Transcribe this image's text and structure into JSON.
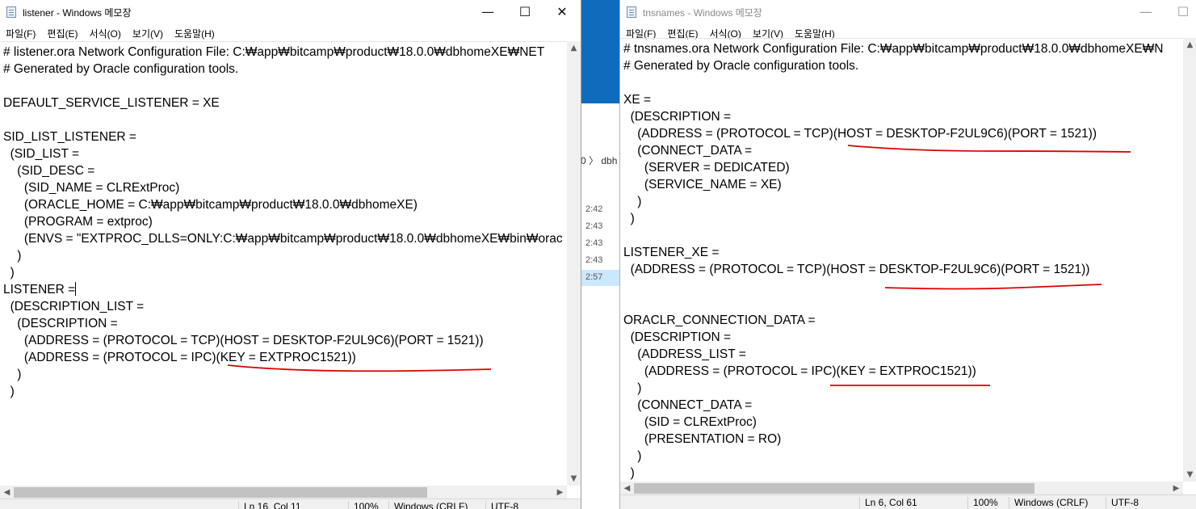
{
  "left_window": {
    "title": "listener - Windows 메모장",
    "controls": {
      "minimize": "—",
      "maximize": "☐",
      "close": "✕"
    },
    "menu": [
      "파일(F)",
      "편집(E)",
      "서식(O)",
      "보기(V)",
      "도움말(H)"
    ],
    "content": "# listener.ora Network Configuration File: C:\\app\\bitcamp\\product\\18.0.0\\dbhomeXE\\NET\n# Generated by Oracle configuration tools.\n\nDEFAULT_SERVICE_LISTENER = XE\n\nSID_LIST_LISTENER =\n  (SID_LIST =\n    (SID_DESC =\n      (SID_NAME = CLRExtProc)\n      (ORACLE_HOME = C:\\app\\bitcamp\\product\\18.0.0\\dbhomeXE)\n      (PROGRAM = extproc)\n      (ENVS = \"EXTPROC_DLLS=ONLY:C:\\app\\bitcamp\\product\\18.0.0\\dbhomeXE\\bin\\orac\n    )\n  )\n",
    "content_tail": "  (DESCRIPTION_LIST =\n    (DESCRIPTION =\n      (ADDRESS = (PROTOCOL = TCP)(HOST = DESKTOP-F2UL9C6)(PORT = 1521))\n      (ADDRESS = (PROTOCOL = IPC)(KEY = EXTPROC1521))\n    )\n  )",
    "listener_line": "LISTENER =",
    "status": {
      "position": "Ln 16, Col 11",
      "zoom": "100%",
      "eol": "Windows (CRLF)",
      "encoding": "UTF-8"
    }
  },
  "right_window": {
    "title": "tnsnames - Windows 메모장",
    "controls": {
      "minimize": "—",
      "maximize": "☐"
    },
    "menu": [
      "파일(F)",
      "편집(E)",
      "서식(O)",
      "보기(V)",
      "도움말(H)"
    ],
    "content": "# tnsnames.ora Network Configuration File: C:\\app\\bitcamp\\product\\18.0.0\\dbhomeXE\\N\n# Generated by Oracle configuration tools.\n\nXE =\n  (DESCRIPTION =\n    (ADDRESS = (PROTOCOL = TCP)(HOST = DESKTOP-F2UL9C6)(PORT = 1521))\n    (CONNECT_DATA =\n      (SERVER = DEDICATED)\n      (SERVICE_NAME = XE)\n    )\n  )\n\nLISTENER_XE =\n  (ADDRESS = (PROTOCOL = TCP)(HOST = DESKTOP-F2UL9C6)(PORT = 1521))\n\n\nORACLR_CONNECTION_DATA =\n  (DESCRIPTION =\n    (ADDRESS_LIST =\n      (ADDRESS = (PROTOCOL = IPC)(KEY = EXTPROC1521))\n    )\n    (CONNECT_DATA =\n      (SID = CLRExtProc)\n      (PRESENTATION = RO)\n    )\n  )",
    "status": {
      "position": "Ln 6, Col 61",
      "zoom": "100%",
      "eol": "Windows (CRLF)",
      "encoding": "UTF-8"
    }
  },
  "background_window": {
    "crumb": "0  〉 dbh",
    "times": [
      "2:42",
      "2:43",
      "2:43",
      "2:43",
      "2:57"
    ]
  },
  "annotation_color": "#e00000"
}
